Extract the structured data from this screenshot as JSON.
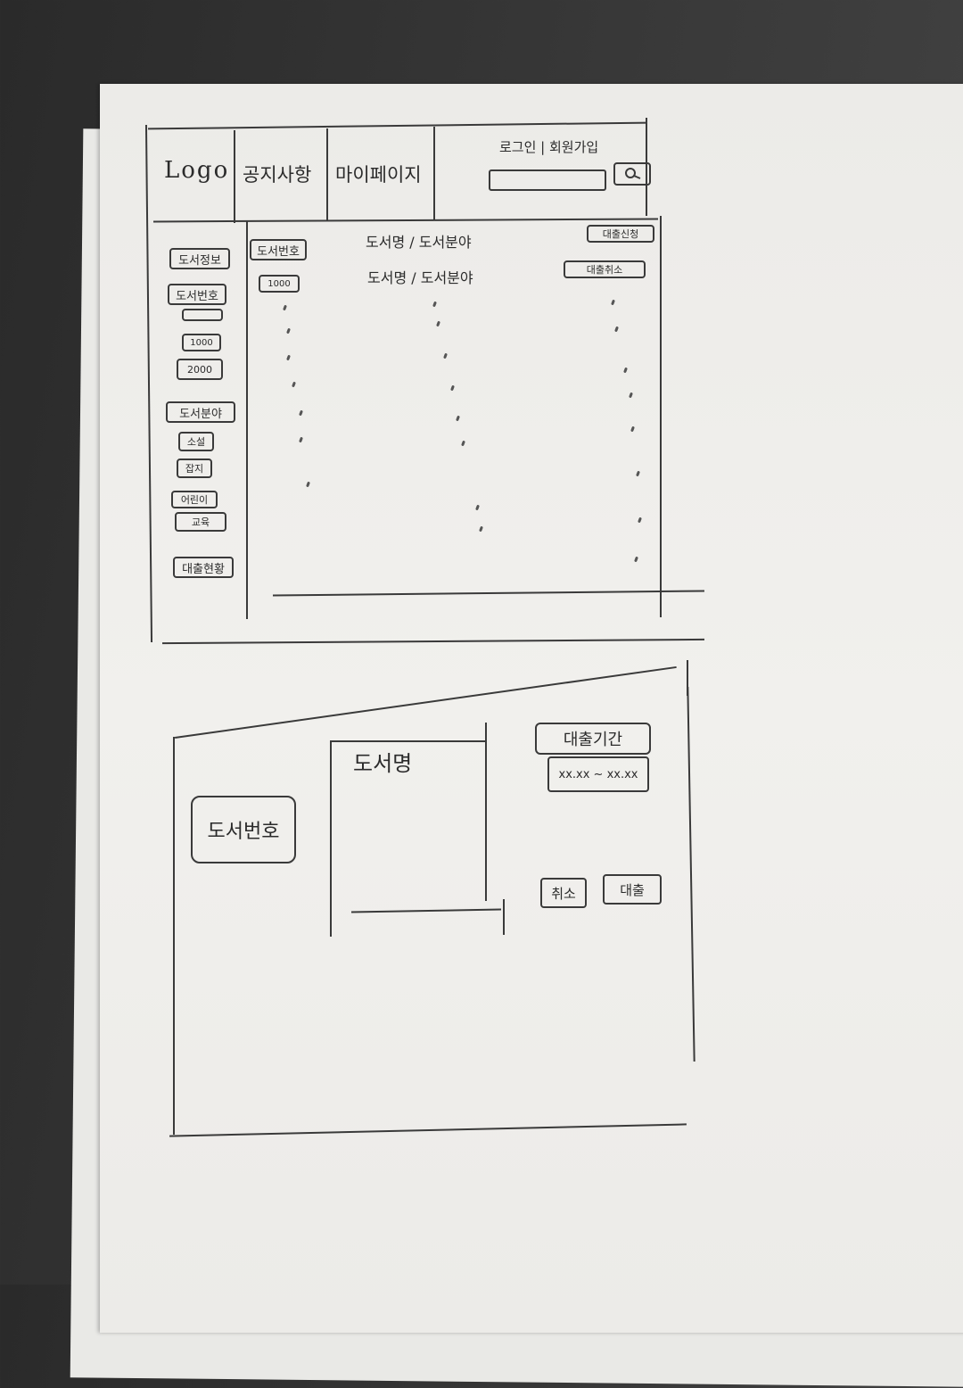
{
  "header": {
    "logo": "Logo",
    "nav": [
      "공지사항",
      "마이페이지"
    ],
    "auth": "로그인 | 회원가입"
  },
  "sidebar": {
    "items": [
      "도서정보",
      "도서번호",
      "1000",
      "2000",
      "도서분야",
      "소설",
      "잡지",
      "어린이",
      "교육",
      "대출현황"
    ]
  },
  "list": {
    "rows": [
      {
        "id": "도서번호",
        "title": "도서명 / 도서분야",
        "action": "대출신청"
      },
      {
        "id": "1000",
        "title": "도서명 / 도서분야",
        "action": "대출취소"
      }
    ]
  },
  "detail": {
    "book_id": "도서번호",
    "book_name": "도서명",
    "period_label": "대출기간",
    "period_value": "xx.xx ~ xx.xx",
    "cancel_label": "취소",
    "loan_label": "대출"
  },
  "colors": {
    "ink": "#2b2b2b",
    "paper": "#eeede9",
    "background": "#333333"
  }
}
